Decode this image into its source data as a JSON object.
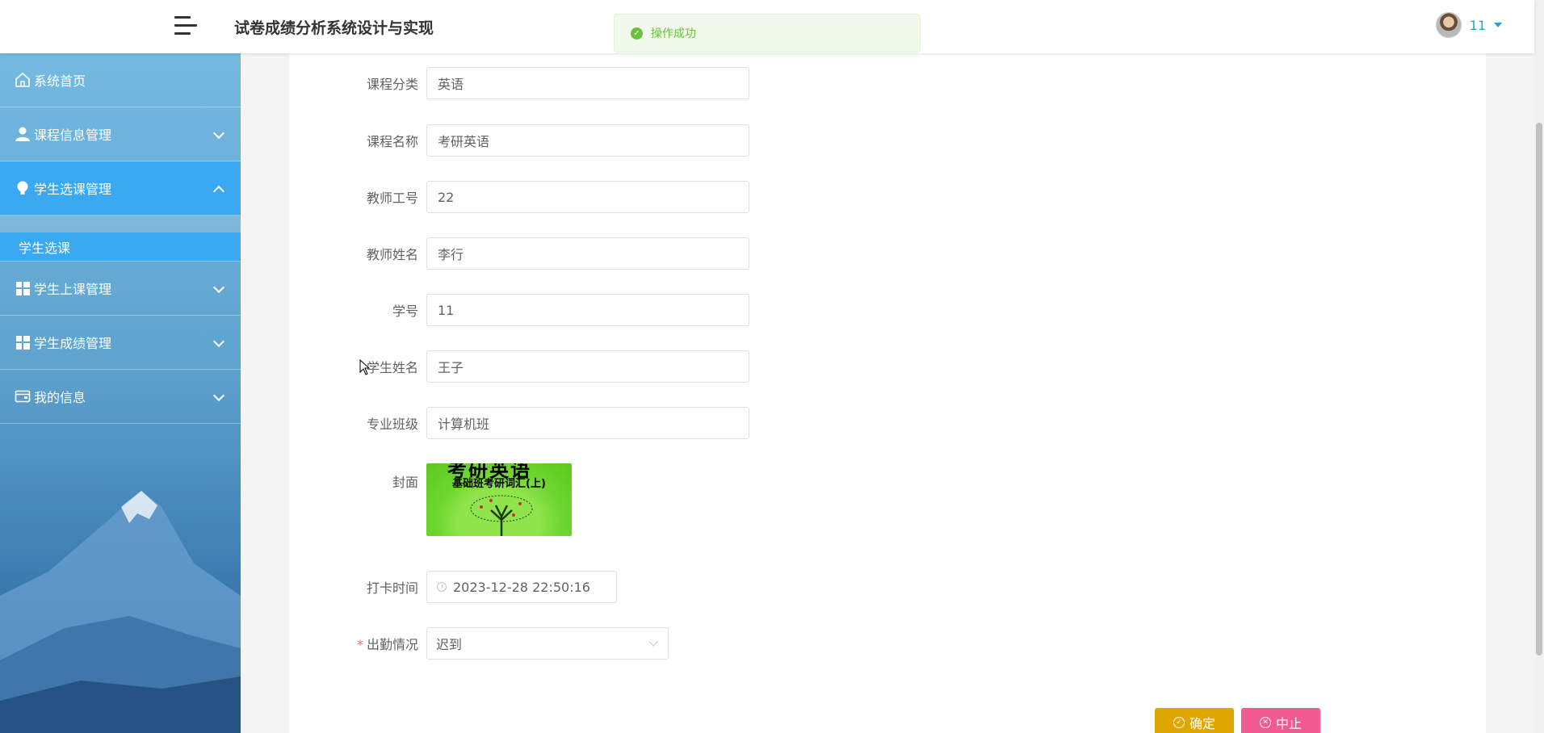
{
  "header": {
    "title": "试卷成绩分析系统设计与实现",
    "user_name": "11"
  },
  "toast": {
    "message": "操作成功",
    "color": "#67c23a"
  },
  "sidebar": {
    "items": [
      {
        "label": "系统首页",
        "icon": "home-icon"
      },
      {
        "label": "课程信息管理",
        "icon": "user-icon"
      },
      {
        "label": "学生选课管理",
        "icon": "bulb-icon",
        "active": true
      },
      {
        "label": "学生上课管理",
        "icon": "grid-icon"
      },
      {
        "label": "学生成绩管理",
        "icon": "grid-icon"
      },
      {
        "label": "我的信息",
        "icon": "wallet-icon"
      }
    ],
    "sub_items": [
      {
        "label": "学生选课",
        "active": true
      }
    ],
    "accent": "#3aa8f2"
  },
  "form": {
    "course_category": {
      "label": "课程分类",
      "value": "英语"
    },
    "course_name": {
      "label": "课程名称",
      "value": "考研英语"
    },
    "teacher_id": {
      "label": "教师工号",
      "value": "22"
    },
    "teacher_name": {
      "label": "教师姓名",
      "value": "李行"
    },
    "student_id": {
      "label": "学号",
      "value": "11"
    },
    "student_name": {
      "label": "学生姓名",
      "value": "王子"
    },
    "major_class": {
      "label": "专业班级",
      "value": "计算机班"
    },
    "cover": {
      "label": "封面",
      "cover_title": "考研英语",
      "cover_subtitle": "基础班考研词汇(上)"
    },
    "checkin_time": {
      "label": "打卡时间",
      "value": "2023-12-28 22:50:16"
    },
    "attendance": {
      "label": "出勤情况",
      "value": "迟到",
      "required_mark": "*"
    }
  },
  "actions": {
    "confirm_label": "确定",
    "stop_label": "中止",
    "confirm_color": "#e0a600",
    "stop_color": "#f25b8f"
  }
}
